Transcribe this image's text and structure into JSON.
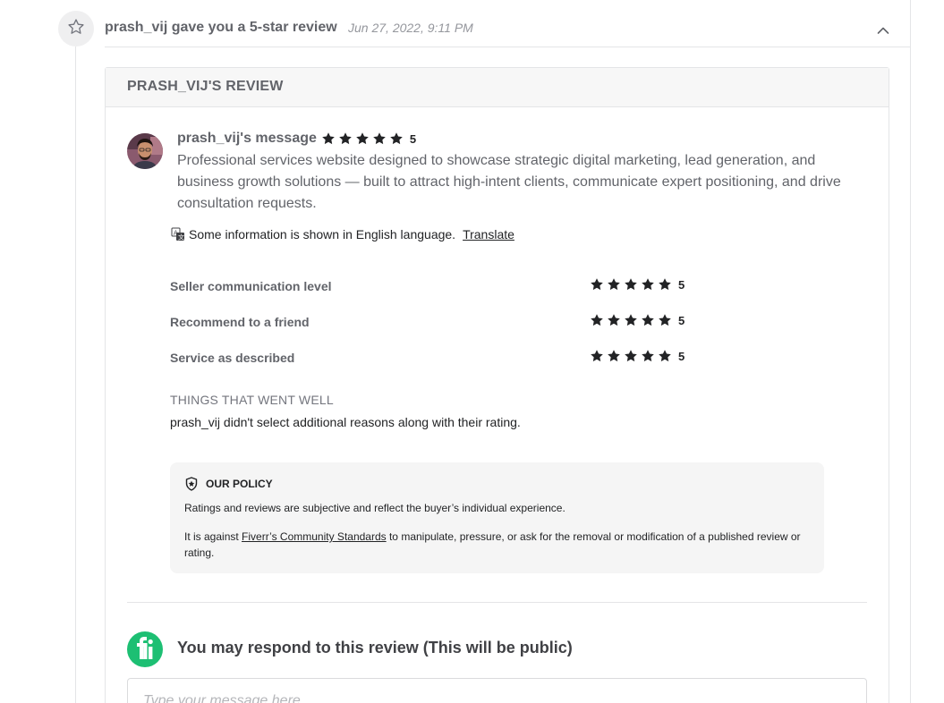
{
  "header": {
    "event_title": "prash_vij gave you a 5-star review",
    "event_date": "Jun 27, 2022, 9:11 PM",
    "event_icon": "star-outline-icon",
    "collapse_icon": "chevron-up-icon"
  },
  "review": {
    "card_title": "PRASH_VIJ'S REVIEW",
    "reviewer_message_title": "prash_vij's message",
    "overall_rating": "5",
    "message": "Professional services website designed to showcase strategic digital marketing, lead generation, and business growth solutions — built to attract high-intent clients, communicate expert positioning, and drive consultation requests.",
    "translate_notice": "Some information is shown in English language.",
    "translate_link": "Translate",
    "sub_ratings": [
      {
        "label": "Seller communication level",
        "value": "5"
      },
      {
        "label": "Recommend to a friend",
        "value": "5"
      },
      {
        "label": "Service as described",
        "value": "5"
      }
    ],
    "went_well_title": "THINGS THAT WENT WELL",
    "went_well_text": "prash_vij didn't select additional reasons along with their rating."
  },
  "policy": {
    "title": "OUR POLICY",
    "p1": "Ratings and reviews are subjective and reflect the buyer’s individual experience.",
    "p2_before": "It is against ",
    "p2_link": "Fiverr’s Community Standards",
    "p2_after": " to manipulate, pressure, or ask for the removal or modification of a published review or rating."
  },
  "respond": {
    "title": "You may respond to this review (This will be public)",
    "placeholder": "Type your message here...",
    "logo_text": "fi"
  },
  "colors": {
    "brand_green": "#1dbf73",
    "star": "#222325",
    "muted_text": "#62646a"
  }
}
